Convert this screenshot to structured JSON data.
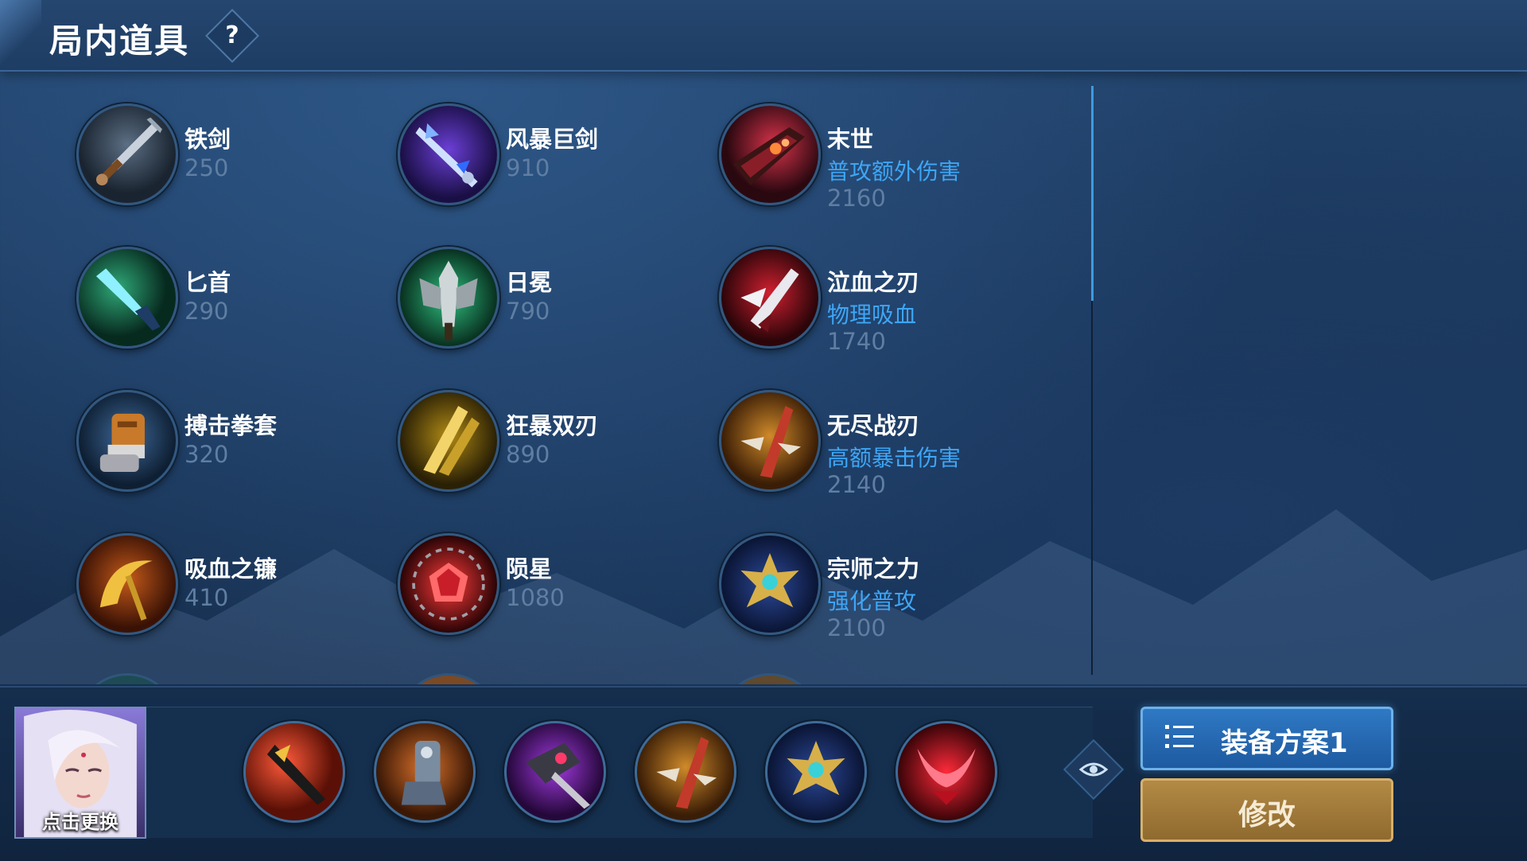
{
  "header": {
    "title": "局内道具",
    "help_label": "?"
  },
  "items": [
    {
      "name": "铁剑",
      "price": "250",
      "effect": ""
    },
    {
      "name": "风暴巨剑",
      "price": "910",
      "effect": ""
    },
    {
      "name": "末世",
      "price": "2160",
      "effect": "普攻额外伤害"
    },
    {
      "name": "匕首",
      "price": "290",
      "effect": ""
    },
    {
      "name": "日冕",
      "price": "790",
      "effect": ""
    },
    {
      "name": "泣血之刃",
      "price": "1740",
      "effect": "物理吸血"
    },
    {
      "name": "搏击拳套",
      "price": "320",
      "effect": ""
    },
    {
      "name": "狂暴双刃",
      "price": "890",
      "effect": ""
    },
    {
      "name": "无尽战刃",
      "price": "2140",
      "effect": "高额暴击伤害"
    },
    {
      "name": "吸血之镰",
      "price": "410",
      "effect": ""
    },
    {
      "name": "陨星",
      "price": "1080",
      "effect": ""
    },
    {
      "name": "宗师之力",
      "price": "2100",
      "effect": "强化普攻"
    }
  ],
  "hero": {
    "label": "点击更换"
  },
  "plan_button": {
    "label": "装备方案1"
  },
  "edit_button": {
    "label": "修改"
  },
  "colors": {
    "effect_text": "#3ea6f5",
    "price_text": "#5f7ea2",
    "plan_button": "#2f79c4",
    "edit_button": "#b38a45"
  },
  "icons": {
    "items": [
      "iron-sword-icon",
      "storm-greatsword-icon",
      "doomsday-icon",
      "dagger-icon",
      "corona-icon",
      "bloodweeper-icon",
      "boxing-gauntlet-icon",
      "berserk-blades-icon",
      "infinity-edge-icon",
      "vampire-scythe-icon",
      "meteor-icon",
      "master-power-icon"
    ],
    "equipped": [
      "shadow-blade-icon",
      "warrior-boots-icon",
      "purple-axe-icon",
      "infinity-edge-icon",
      "master-power-icon",
      "crimson-horns-icon"
    ]
  }
}
